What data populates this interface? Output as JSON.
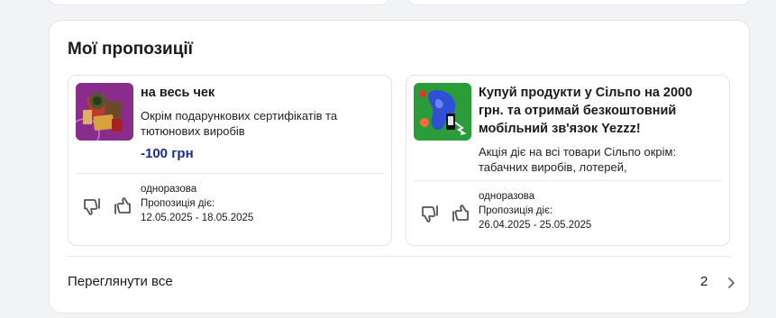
{
  "section": {
    "title": "Мої пропозиції"
  },
  "offers": [
    {
      "title": "на весь чек",
      "description": "Окрім подарункових сертифікатів та тютюнових виробів",
      "value": "-100 грн",
      "frequency": "одноразова",
      "validity_label": "Пропозиція діє:",
      "validity_dates": "12.05.2025 - 18.05.2025",
      "icon": "gift-collage-thumbnail"
    },
    {
      "title": "Купуй продукти у Сільпо на 2000 грн. та отримай безкоштовний мобільний зв'язок Yezzz!",
      "description": "Акція діє на всі товари Сільпо окрім: табачних виробів, лотерей,",
      "frequency": "одноразова",
      "validity_label": "Пропозиція діє:",
      "validity_dates": "26.04.2025 - 25.05.2025",
      "icon": "yezzz-promo-thumbnail"
    }
  ],
  "footer": {
    "view_all_label": "Переглянути все",
    "count": "2"
  },
  "colors": {
    "value_text": "#1a2c8f",
    "thumb1_bg": "#8a2c8c",
    "thumb2_bg": "#2a9d3a"
  }
}
